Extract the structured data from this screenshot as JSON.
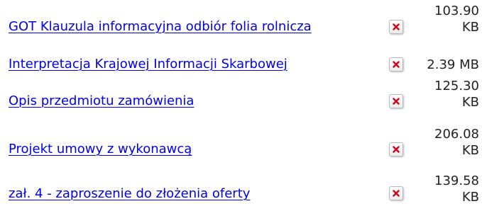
{
  "link_color": "#0000ee",
  "icon_name": "broken-image-icon",
  "files": [
    {
      "name": "GOT Klauzula informacyjna odbiór folia rolnicza",
      "size_value": "103.90",
      "size_unit": "KB"
    },
    {
      "name": "Interpretacja Krajowej Informacji Skarbowej",
      "size_value": "2.39",
      "size_unit": "MB"
    },
    {
      "name": "Opis przedmiotu zamówienia",
      "size_value": "125.30",
      "size_unit": "KB"
    },
    {
      "name": "Projekt umowy z wykonawcą",
      "size_value": "206.08",
      "size_unit": "KB"
    },
    {
      "name": "zał. 4 - zaproszenie do złożenia oferty",
      "size_value": "139.58",
      "size_unit": "KB"
    }
  ]
}
